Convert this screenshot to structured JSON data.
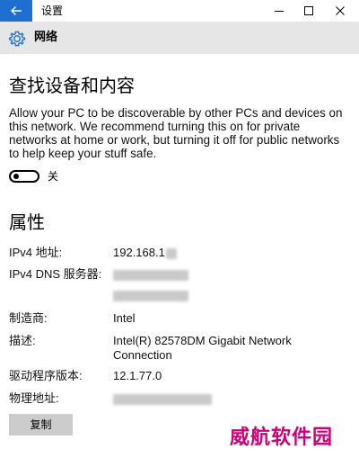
{
  "titlebar": {
    "title": "设置",
    "back_icon": "arrow-left-icon",
    "minimize_icon": "minimize-icon",
    "maximize_icon": "maximize-icon",
    "close_icon": "close-icon",
    "accent_color": "#1f6fd0"
  },
  "header": {
    "title": "网络",
    "icon": "gear-icon"
  },
  "discovery": {
    "heading": "查找设备和内容",
    "description": "Allow your PC to be discoverable by other PCs and devices on this network. We recommend turning this on for private networks at home or work, but turning it off for public networks to help keep your stuff safe.",
    "toggle_state": "关"
  },
  "properties": {
    "heading": "属性",
    "rows": [
      {
        "label": "IPv4 地址:",
        "value": "192.168.1"
      },
      {
        "label": "IPv4 DNS 服务器:",
        "value": ""
      },
      {
        "label": "制造商:",
        "value": "Intel"
      },
      {
        "label": "描述:",
        "value": "Intel(R) 82578DM Gigabit Network Connection"
      },
      {
        "label": "驱动程序版本:",
        "value": "12.1.77.0"
      },
      {
        "label": "物理地址:",
        "value": ""
      }
    ],
    "copy_label": "复制"
  },
  "watermark": "威航软件园"
}
